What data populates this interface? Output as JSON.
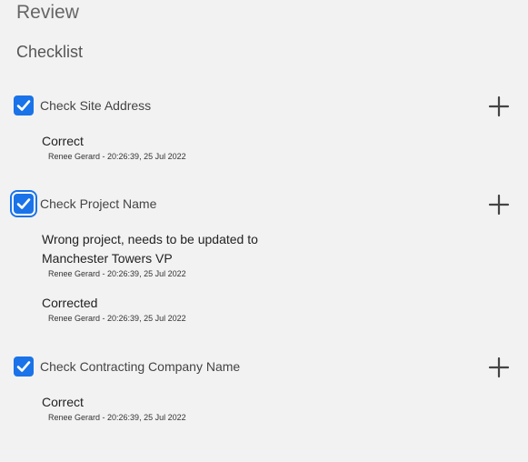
{
  "header": {
    "title": "Review",
    "section_title": "Checklist"
  },
  "colors": {
    "checkbox": "#1a73e8",
    "background": "#f2f2f2"
  },
  "items": [
    {
      "label": "Check Site Address",
      "checked": true,
      "add_icon": "plus-icon",
      "comments": [
        {
          "text": "Correct",
          "meta": "Renee Gerard - 20:26:39, 25 Jul 2022"
        }
      ]
    },
    {
      "label": "Check Project Name",
      "checked": true,
      "add_icon": "plus-icon",
      "comments": [
        {
          "text": "Wrong project, needs to be updated to Manchester Towers VP",
          "meta": "Renee Gerard - 20:26:39, 25 Jul 2022"
        },
        {
          "text": "Corrected",
          "meta": "Renee Gerard - 20:26:39, 25 Jul 2022"
        }
      ]
    },
    {
      "label": "Check Contracting Company Name",
      "checked": true,
      "add_icon": "plus-icon",
      "comments": [
        {
          "text": "Correct",
          "meta": "Renee Gerard - 20:26:39, 25 Jul 2022"
        }
      ]
    }
  ]
}
